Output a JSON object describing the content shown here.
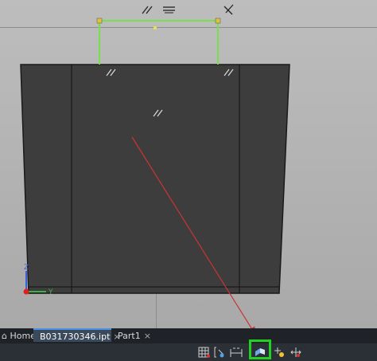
{
  "viewport": {
    "axis": {
      "z_label": "Z",
      "y_label": "Y"
    },
    "constraint_glyphs": [
      "//",
      "//",
      "//"
    ]
  },
  "tabs": {
    "home": {
      "label": "Home"
    },
    "file": {
      "label": "B031730346.ipt",
      "close": "×"
    },
    "part": {
      "label": "Part1",
      "close": "×"
    }
  },
  "status_icons": [
    "grid-icon",
    "sketch-icon",
    "dimension-icon",
    "shaded-view-icon",
    "light-icon",
    "move-icon"
  ],
  "colors": {
    "highlight": "#22d022",
    "sketch_line": "#77e04a",
    "arrow": "#cc3333",
    "body": "#3f3f3f"
  }
}
